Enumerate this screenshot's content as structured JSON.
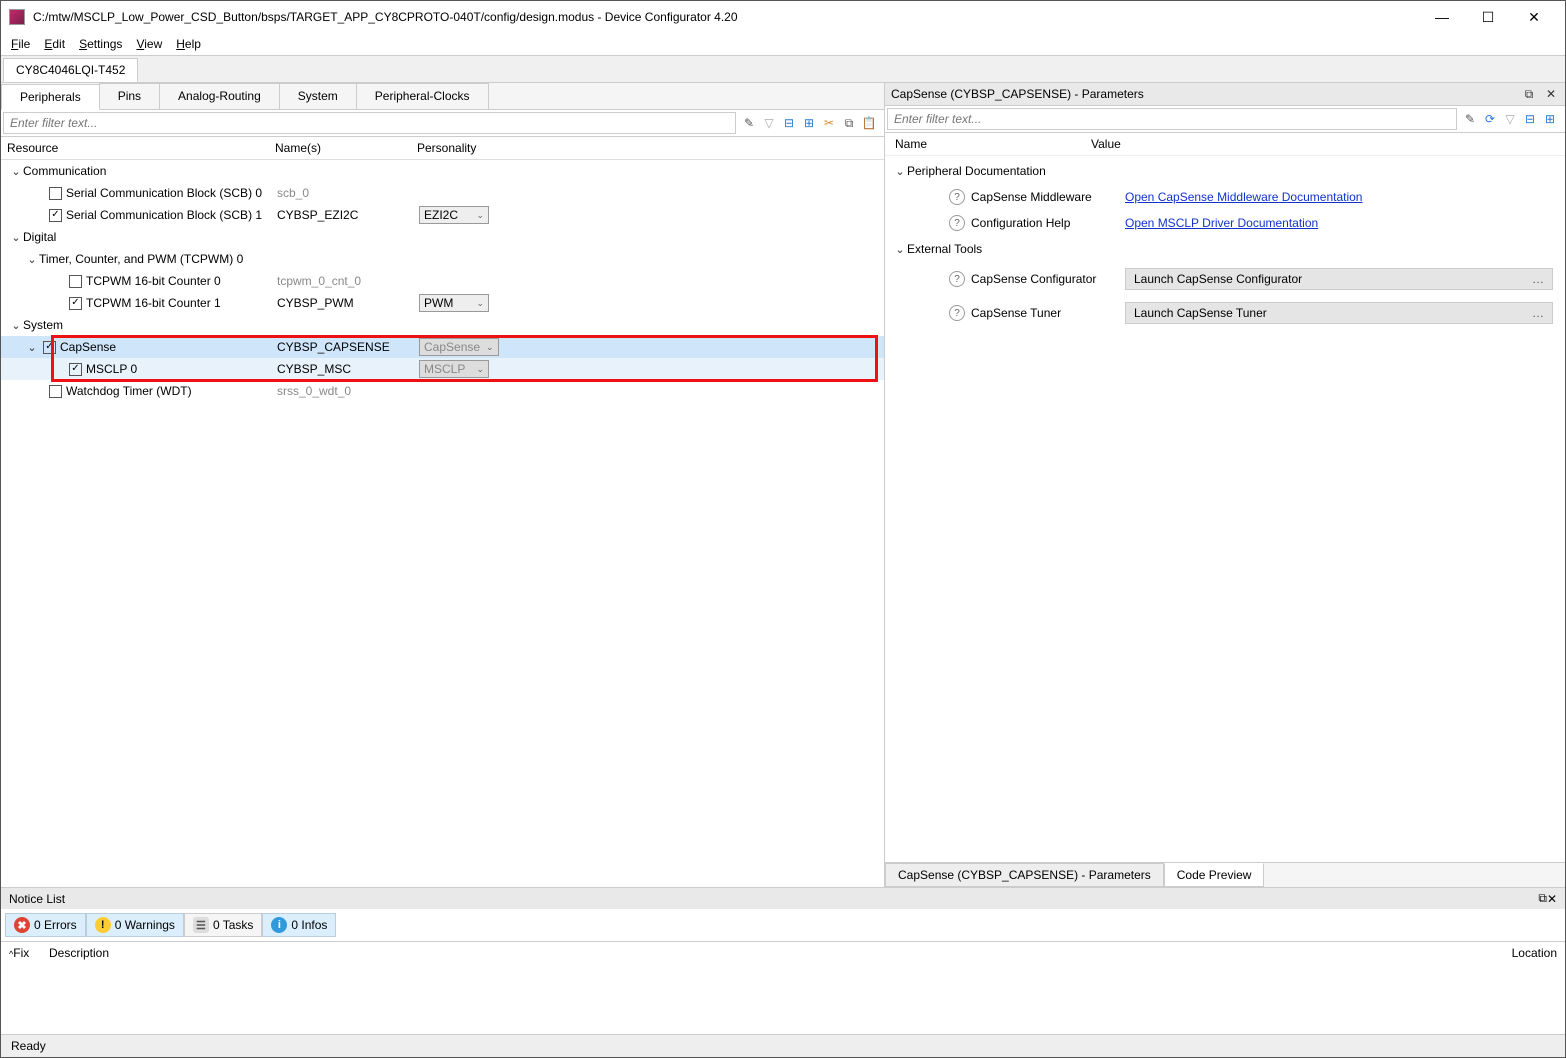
{
  "window": {
    "title": "C:/mtw/MSCLP_Low_Power_CSD_Button/bsps/TARGET_APP_CY8CPROTO-040T/config/design.modus - Device Configurator 4.20"
  },
  "menu": {
    "file": "File",
    "edit": "Edit",
    "settings": "Settings",
    "view": "View",
    "help": "Help"
  },
  "device_tab": "CY8C4046LQI-T452",
  "tabs": {
    "peripherals": "Peripherals",
    "pins": "Pins",
    "analog": "Analog-Routing",
    "system": "System",
    "pclocks": "Peripheral-Clocks"
  },
  "filter_placeholder": "Enter filter text...",
  "cols": {
    "resource": "Resource",
    "names": "Name(s)",
    "personality": "Personality"
  },
  "tree": {
    "comm": "Communication",
    "scb0": "Serial Communication Block (SCB) 0",
    "scb0_name": "scb_0",
    "scb1": "Serial Communication Block (SCB) 1",
    "scb1_name": "CYBSP_EZI2C",
    "scb1_pers": "EZI2C",
    "digital": "Digital",
    "tcpwm": "Timer, Counter, and PWM (TCPWM) 0",
    "tc0": "TCPWM 16-bit Counter 0",
    "tc0_name": "tcpwm_0_cnt_0",
    "tc1": "TCPWM 16-bit Counter 1",
    "tc1_name": "CYBSP_PWM",
    "tc1_pers": "PWM",
    "system": "System",
    "capsense": "CapSense",
    "capsense_name": "CYBSP_CAPSENSE",
    "capsense_pers": "CapSense",
    "msclp": "MSCLP 0",
    "msclp_name": "CYBSP_MSC",
    "msclp_pers": "MSCLP",
    "wdt": "Watchdog Timer (WDT)",
    "wdt_name": "srss_0_wdt_0"
  },
  "right": {
    "title": "CapSense (CYBSP_CAPSENSE) - Parameters",
    "name_col": "Name",
    "value_col": "Value",
    "grp_doc": "Peripheral Documentation",
    "mw": "CapSense Middleware",
    "mw_link": "Open CapSense Middleware Documentation",
    "cfg": "Configuration Help",
    "cfg_link": "Open MSCLP Driver Documentation",
    "grp_tools": "External Tools",
    "conf": "CapSense Configurator",
    "conf_btn": "Launch CapSense Configurator",
    "tuner": "CapSense Tuner",
    "tuner_btn": "Launch CapSense Tuner",
    "bottom_params": "CapSense (CYBSP_CAPSENSE) - Parameters",
    "bottom_code": "Code Preview"
  },
  "notice": {
    "title": "Notice List",
    "errors": "0 Errors",
    "warnings": "0 Warnings",
    "tasks": "0 Tasks",
    "infos": "0 Infos",
    "fix": "Fix",
    "description": "Description",
    "location": "Location"
  },
  "status": "Ready"
}
